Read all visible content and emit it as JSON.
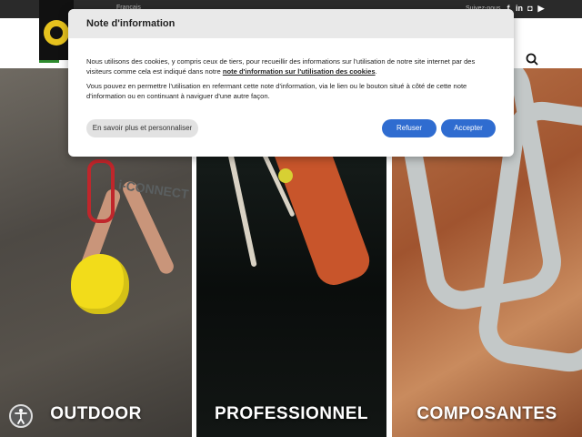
{
  "topbar": {
    "language": "Français",
    "follow": "Suivez-nous"
  },
  "social": [
    {
      "name": "facebook-icon",
      "glyph": "f"
    },
    {
      "name": "linkedin-icon",
      "glyph": "in"
    },
    {
      "name": "instagram-icon",
      "glyph": "◘"
    },
    {
      "name": "youtube-icon",
      "glyph": "▶"
    }
  ],
  "modal": {
    "title": "Note d'information",
    "para1_start": "Nous utilisons des cookies, y compris ceux de tiers, pour recueillir des informations sur l'utilisation de notre site internet par des visiteurs comme cela est indiqué dans notre ",
    "para1_link": "note d'information sur l'utilisation des cookies",
    "para1_end": ".",
    "para2": "Vous pouvez en permettre l'utilisation en refermant cette note d'information, via le lien ou le bouton situé à côté de cette note d'information ou en continuant à naviguer d'une autre façon.",
    "btn_more": "En savoir plus et personnaliser",
    "btn_refuse": "Refuser",
    "btn_accept": "Accepter"
  },
  "tiles": [
    {
      "label": "OUTDOOR"
    },
    {
      "label": "PROFESSIONNEL"
    },
    {
      "label": "COMPOSANTES"
    }
  ],
  "product_text": "i-CONNECT",
  "colors": {
    "accent": "#2f6cd0",
    "logo_yellow": "#e6c21e"
  }
}
